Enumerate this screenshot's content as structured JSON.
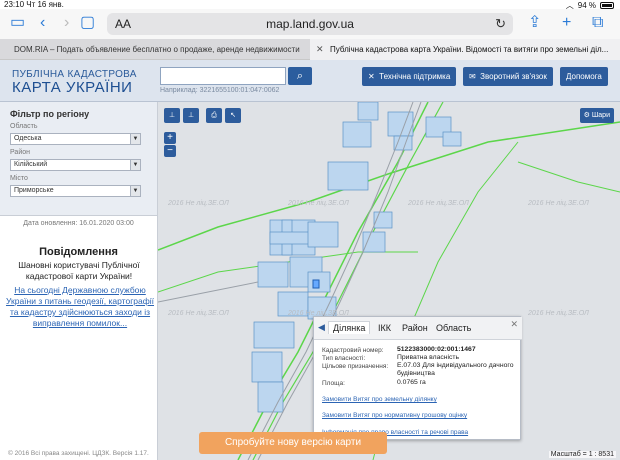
{
  "status_bar": {
    "time_date": "23:10  Чт 16 янв.",
    "battery": "94 %"
  },
  "browser": {
    "aa_label": "AA",
    "url": "map.land.gov.ua",
    "tabs": [
      {
        "title": "DOM.RIA – Подать объявление бесплатно о продаже, аренде недвижимости"
      },
      {
        "title": "Публічна кадастрова карта України. Відомості та витяги про земельні діл..."
      }
    ]
  },
  "header": {
    "logo_line1": "ПУБЛІЧНА КАДАСТРОВА",
    "logo_line2": "КАРТА УКРАЇНИ",
    "search_hint": "Наприклад: 3221655100:01:047:0062",
    "buttons": {
      "support": "Технічна підтримка",
      "feedback": "Зворотний зв'язок",
      "help": "Допомога"
    }
  },
  "filter": {
    "title": "Фільтр по регіону",
    "region_label": "Область",
    "region_value": "Одеська",
    "district_label": "Район",
    "district_value": "Кілійський",
    "city_label": "Місто",
    "city_value": "Приморське"
  },
  "update_date": "Дата оновлення: 16.01.2020 03:00",
  "notice": {
    "title": "Повідомлення",
    "text": "Шановні користувачі Публічної кадастрової карти України!",
    "link": "На сьогодні Державною службою України з питань геодезії, картографії та кадастру здійснюються заходи із виправлення помилок..."
  },
  "copyright": "© 2016 Всі права захищені. ЦДЗК. Версія 1.17.",
  "map": {
    "layers_label": "Шари",
    "zoom_in": "+",
    "zoom_out": "−",
    "watermark": "2016 Не лiц.ЗЕ.ОЛ"
  },
  "popup": {
    "tabs": [
      "Ділянка",
      "ІКК",
      "Район",
      "Область"
    ],
    "rows": [
      {
        "label": "Кадастровий номер:",
        "value": "5122383000:02:001:1467"
      },
      {
        "label": "Тип власності:",
        "value": "Приватна власність"
      },
      {
        "label": "Цільове призначення:",
        "value": "Е.07.03 Для індивідуального дачного будівництва"
      },
      {
        "label": "Площа:",
        "value": "0.0765 га"
      }
    ],
    "links": [
      "Замовити Витяг про земельну ділянку",
      "Замовити Витяг про нормативну грошову оцінку",
      "Інформація про право власності та речові права"
    ]
  },
  "banner": "Спробуйте нову версію карти",
  "scale": "Масштаб = 1 : 8531"
}
